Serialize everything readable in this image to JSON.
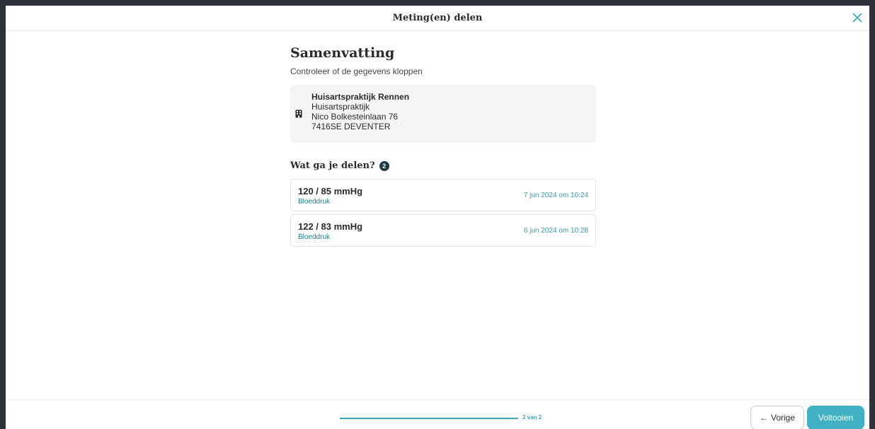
{
  "header": {
    "title": "Meting(en) delen"
  },
  "summary": {
    "title": "Samenvatting",
    "subtitle": "Controleer of de gegevens kloppen"
  },
  "practice": {
    "icon": "building-icon",
    "name": "Huisartspraktijk Rennen",
    "type": "Huisartspraktijk",
    "street": "Nico Bolkesteinlaan 76",
    "city": "7416SE DEVENTER"
  },
  "share": {
    "heading": "Wat ga je delen?",
    "count": "2",
    "items": [
      {
        "value": "120 / 85 mmHg",
        "type": "Bloeddruk",
        "date": "7 jun 2024 om 10:24"
      },
      {
        "value": "122 / 83 mmHg",
        "type": "Bloeddruk",
        "date": "6 jun 2024 om 10:28"
      }
    ]
  },
  "footer": {
    "progress_label": "2 van 2",
    "progress_fraction": 1.0,
    "prev_arrow": "←",
    "prev_label": "Vorige",
    "finish_label": "Voltooien"
  },
  "colors": {
    "accent": "#3fb1c3",
    "badge": "#1e3a46",
    "link": "#1f7d8c"
  }
}
